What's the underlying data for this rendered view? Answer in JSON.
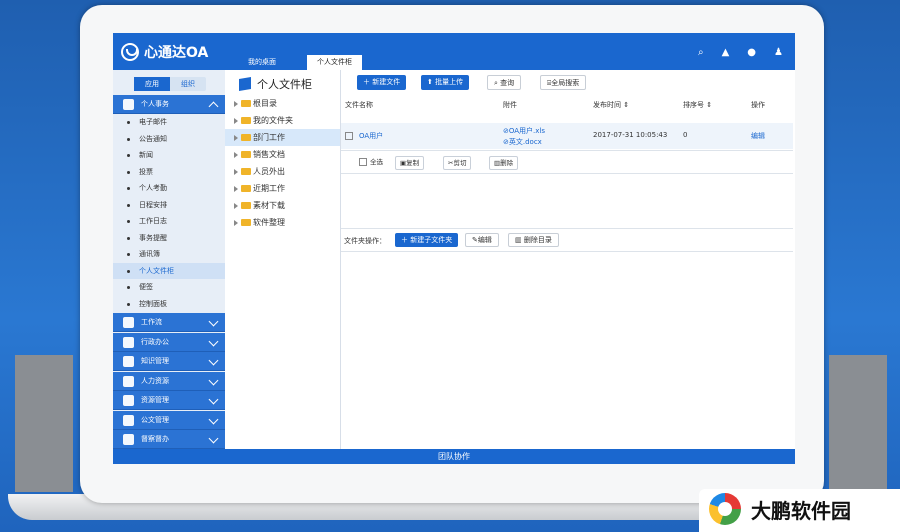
{
  "app": {
    "logo_text": "心通达OA",
    "tabs": [
      "我的桌面",
      "个人文件柜"
    ],
    "active_tab": 1,
    "footer": "团队协作",
    "brand_watermark": "大鹏软件园"
  },
  "colors": {
    "primary": "#1a67cf",
    "sidebar_bg": "#e7eef7",
    "active_row": "#cfe0f5"
  },
  "left_nav": {
    "segments": [
      "应用",
      "组织"
    ],
    "active_segment": 0,
    "groups": [
      {
        "label": "个人事务",
        "icon": "person-icon",
        "expanded": true
      },
      {
        "label": "工作流",
        "icon": "calendar-icon"
      },
      {
        "label": "行政办公",
        "icon": "admin-icon"
      },
      {
        "label": "知识管理",
        "icon": "knowledge-icon"
      },
      {
        "label": "人力资源",
        "icon": "hr-icon"
      },
      {
        "label": "资源管理",
        "icon": "layers-icon"
      },
      {
        "label": "公文管理",
        "icon": "document-icon"
      },
      {
        "label": "督察督办",
        "icon": "inspect-icon"
      }
    ],
    "items": [
      "电子邮件",
      "公告通知",
      "新闻",
      "投票",
      "个人考勤",
      "日程安排",
      "工作日志",
      "事务提醒",
      "通讯簿",
      "个人文件柜",
      "便签",
      "控制面板"
    ],
    "active_item": 9
  },
  "tree": {
    "title": "个人文件柜",
    "nodes": [
      "根目录",
      "我的文件夹",
      "部门工作",
      "销售文档",
      "人员外出",
      "近期工作",
      "素材下载",
      "软件整理"
    ],
    "active_node": 2
  },
  "toolbar": {
    "new_file": "新建文件",
    "batch_upload": "批量上传",
    "query": "查询",
    "global_search": "全局搜索"
  },
  "table": {
    "headers": [
      "文件名称",
      "附件",
      "发布时间",
      "排序号",
      "操作"
    ],
    "rows": [
      {
        "name": "OA用户",
        "attachments": [
          "OA用户.xls",
          "英文.docx"
        ],
        "time": "2017-07-31 10:05:43",
        "order": "0",
        "action": "编辑"
      }
    ]
  },
  "bulk_actions": {
    "select_all": "全选",
    "copy": "复制",
    "cut": "剪切",
    "delete": "删除"
  },
  "folder_ops": {
    "label": "文件夹操作：",
    "new_subfolder": "新建子文件夹",
    "edit": "编辑",
    "delete_dir": "删除目录"
  }
}
